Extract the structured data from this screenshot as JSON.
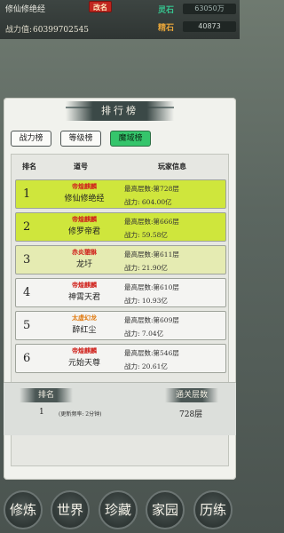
{
  "header": {
    "player_name": "修仙修绝经",
    "rename_label": "改名",
    "power_label": "战力值:",
    "power_value": "60399702545",
    "resources": [
      {
        "label": "灵石",
        "value": "63050万"
      },
      {
        "label": "精石",
        "value": "40873"
      }
    ]
  },
  "panel": {
    "title": "排行榜",
    "tabs": [
      {
        "label": "战力榜",
        "active": false
      },
      {
        "label": "等级榜",
        "active": false
      },
      {
        "label": "魔域榜",
        "active": true
      }
    ],
    "columns": [
      "排名",
      "道号",
      "玩家信息"
    ],
    "rows": [
      {
        "rank": "1",
        "sect": "帝煌麒麟",
        "name": "修仙修绝经",
        "floor": "最高层数:第728层",
        "power": "战力: 604.00亿",
        "color": "#cfe63c"
      },
      {
        "rank": "2",
        "sect": "帝煌麒麟",
        "name": "修罗帝君",
        "floor": "最高层数:第666层",
        "power": "战力: 59.58亿",
        "color": "#cfe63c"
      },
      {
        "rank": "3",
        "sect": "赤炎貔貅",
        "name": "龙圩",
        "floor": "最高层数:第611层",
        "power": "战力: 21.90亿",
        "color": "#e5ebb2"
      },
      {
        "rank": "4",
        "sect": "帝煌麒麟",
        "name": "神霄天君",
        "floor": "最高层数:第610层",
        "power": "战力: 10.93亿",
        "color": "#f4f4f2"
      },
      {
        "rank": "5",
        "sect": "太虚幻龙",
        "name": "醉红尘",
        "floor": "最高层数:第609层",
        "power": "战力: 7.04亿",
        "color": "#f4f4f2"
      },
      {
        "rank": "6",
        "sect": "帝煌麒麟",
        "name": "元始天尊",
        "floor": "最高层数:第546层",
        "power": "战力: 20.61亿",
        "color": "#f4f4f2"
      }
    ],
    "sect_colors": {
      "帝煌麒麟": "#d0221c",
      "赤炎貔貅": "#d0221c",
      "太虚幻龙": "#e07a10"
    }
  },
  "mine": {
    "rank_label": "排名",
    "rank_value": "1",
    "refresh_note": "(更新频率: 2分钟)",
    "floor_label": "通关层数",
    "floor_value": "728层"
  },
  "nav": [
    {
      "label": "修炼"
    },
    {
      "label": "世界"
    },
    {
      "label": "珍藏"
    },
    {
      "label": "家园"
    },
    {
      "label": "历练"
    }
  ]
}
